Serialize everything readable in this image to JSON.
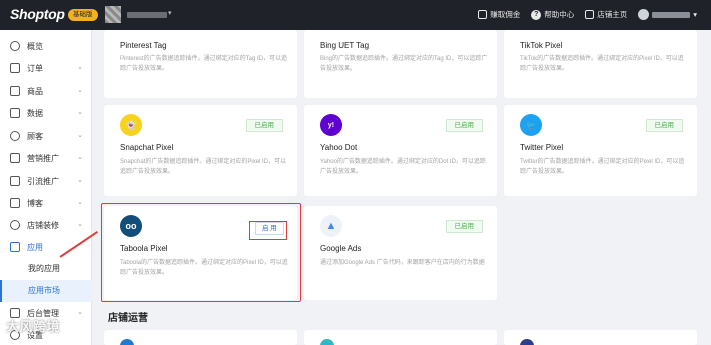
{
  "topbar": {
    "logo": "Shoptop",
    "plan_badge": "基础版",
    "links": [
      {
        "label": "赚取佣金",
        "icon": "gift-icon"
      },
      {
        "label": "帮助中心",
        "icon": "help-icon"
      },
      {
        "label": "店铺主页",
        "icon": "home-icon"
      }
    ]
  },
  "sidebar": {
    "items": [
      {
        "label": "概览",
        "icon": "dashboard-icon"
      },
      {
        "label": "订单",
        "icon": "order-icon"
      },
      {
        "label": "商品",
        "icon": "product-icon"
      },
      {
        "label": "数据",
        "icon": "data-icon"
      },
      {
        "label": "顾客",
        "icon": "customer-icon"
      },
      {
        "label": "营销推广",
        "icon": "marketing-icon"
      },
      {
        "label": "引流推广",
        "icon": "traffic-icon"
      },
      {
        "label": "博客",
        "icon": "blog-icon"
      },
      {
        "label": "店铺装修",
        "icon": "design-icon"
      },
      {
        "label": "应用",
        "icon": "apps-icon"
      }
    ],
    "sub_items": [
      {
        "label": "我的应用"
      },
      {
        "label": "应用市场"
      }
    ],
    "bottom_items": [
      {
        "label": "后台管理",
        "icon": "admin-icon"
      },
      {
        "label": "设置",
        "icon": "settings-icon"
      }
    ],
    "watermark": "大风跨境"
  },
  "cards": [
    {
      "title": "Pinterest Tag",
      "desc": "Pinterest的广告数据追踪插件。通过绑定对应的Tag ID，可以追踪广告投放效果。"
    },
    {
      "title": "Bing UET Tag",
      "desc": "Bing的广告数据追踪插件。通过绑定对应的Tag ID，可以追踪广告投放效果。"
    },
    {
      "title": "TikTok Pixel",
      "desc": "TikTok的广告数据追踪插件。通过绑定对应的Pixel ID，可以追踪广告投放效果。"
    },
    {
      "title": "Snapchat Pixel",
      "status": "已启用",
      "desc": "Snapchat的广告数据追踪插件。通过绑定对应的Pixel ID，可以追踪广告投放效果。",
      "color": "#f7d21e"
    },
    {
      "title": "Yahoo Dot",
      "status": "已启用",
      "desc": "Yahoo的广告数据追踪插件。通过绑定对应的Dot ID，可以追踪广告投放效果。",
      "color": "#5f01d1"
    },
    {
      "title": "Twitter Pixel",
      "status": "已启用",
      "desc": "Twitter的广告数据追踪插件。通过绑定对应的Pixel ID，可以追踪广告投放效果。",
      "color": "#1da1f2"
    },
    {
      "title": "Taboola Pixel",
      "button": "启 用",
      "desc": "Taboola的广告数据追踪插件。通过绑定对应的Pixel ID，可以追踪广告投放效果。",
      "color": "#134e7a"
    },
    {
      "title": "Google Ads",
      "status": "已启用",
      "desc": "通过添加Google Ads 广告代码，来跟踪客户在店内的行为数据",
      "color": "#4285f4"
    }
  ],
  "section": {
    "title": "店铺运营"
  },
  "colors": {
    "accent": "#2b73d6",
    "enabled": "#4caf50",
    "highlight": "#e13a3a"
  }
}
